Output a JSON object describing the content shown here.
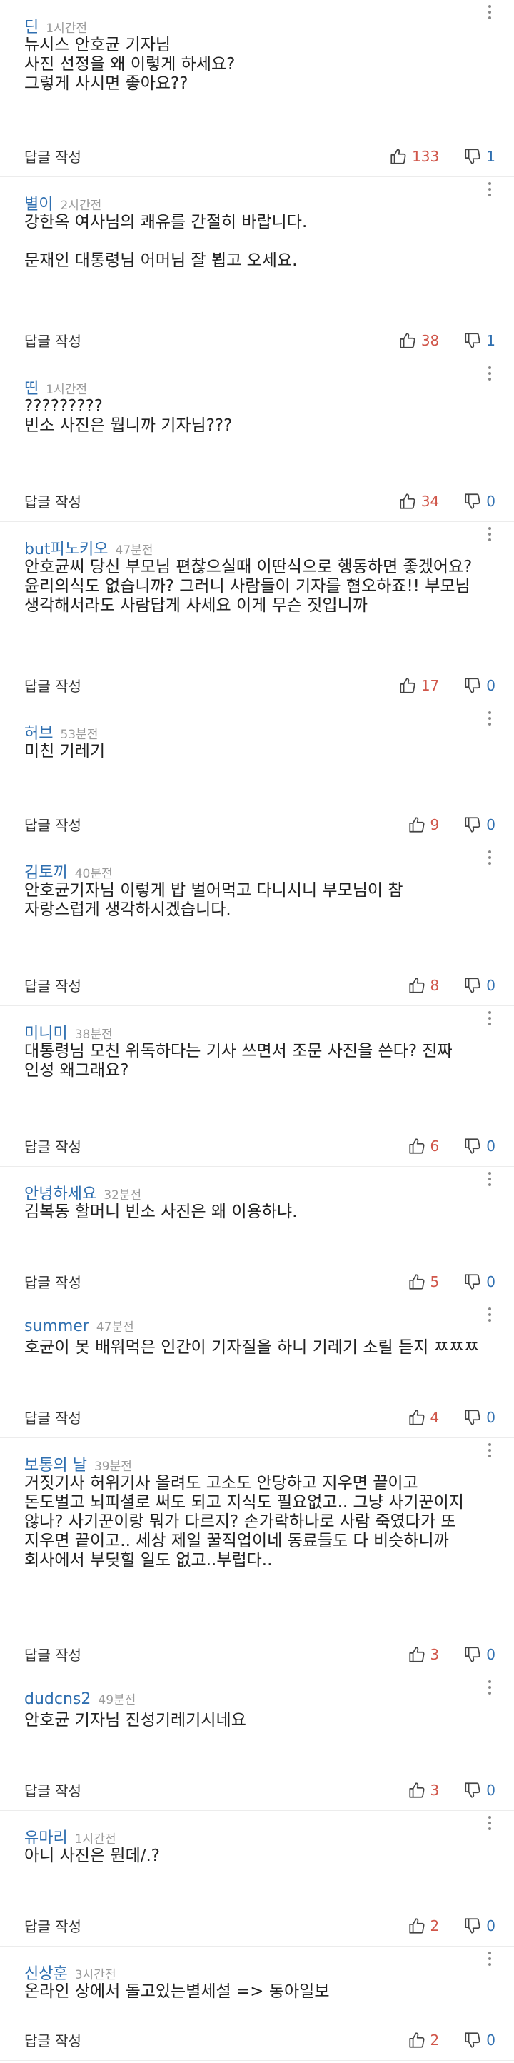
{
  "ui": {
    "reply_label": "답글 작성",
    "icons": {
      "more": "more-vertical-icon",
      "like": "thumbs-up-icon",
      "dislike": "thumbs-down-icon"
    }
  },
  "comments": [
    {
      "nickname": "딘",
      "time": "1시간전",
      "lines": [
        "뉴시스 안호균 기자님",
        "사진 선정을 왜 이렇게 하세요?",
        "그렇게 사시면 좋아요??"
      ],
      "likes": "133",
      "dislikes": "1"
    },
    {
      "nickname": "별이",
      "time": "2시간전",
      "lines": [
        "강한옥 여사님의 쾌유를 간절히 바랍니다.",
        "",
        "문재인 대통령님 어머님 잘 뵙고 오세요."
      ],
      "likes": "38",
      "dislikes": "1"
    },
    {
      "nickname": "띤",
      "time": "1시간전",
      "lines": [
        "?????????",
        "빈소 사진은 뭡니까 기자님???"
      ],
      "likes": "34",
      "dislikes": "0"
    },
    {
      "nickname": "but피노키오",
      "time": "47분전",
      "lines": [
        "안호균씨 당신 부모님 편찮으실때 이딴식으로 행동하면 좋겠어요?",
        "윤리의식도 없습니까? 그러니 사람들이 기자를 혐오하죠!! 부모님",
        "생각해서라도 사람답게 사세요 이게 무슨 짓입니까"
      ],
      "likes": "17",
      "dislikes": "0"
    },
    {
      "nickname": "허브",
      "time": "53분전",
      "lines": [
        "미친 기레기"
      ],
      "likes": "9",
      "dislikes": "0"
    },
    {
      "nickname": "김토끼",
      "time": "40분전",
      "lines": [
        "안호균기자님 이렇게 밥 벌어먹고 다니시니 부모님이 참",
        "자랑스럽게 생각하시겠습니다."
      ],
      "likes": "8",
      "dislikes": "0"
    },
    {
      "nickname": "미니미",
      "time": "38분전",
      "lines": [
        "대통령님 모친 위독하다는 기사 쓰면서 조문 사진을 쓴다? 진짜",
        "인성 왜그래요?"
      ],
      "likes": "6",
      "dislikes": "0"
    },
    {
      "nickname": "안녕하세요",
      "time": "32분전",
      "lines": [
        "김복동 할머니 빈소 사진은 왜 이용하냐."
      ],
      "likes": "5",
      "dislikes": "0"
    },
    {
      "nickname": "summer",
      "time": "47분전",
      "lines": [
        "호균이 못 배워먹은 인간이 기자질을 하니 기레기 소릴 듣지 ㅉㅉㅉ"
      ],
      "likes": "4",
      "dislikes": "0"
    },
    {
      "nickname": "보통의 날",
      "time": "39분전",
      "lines": [
        "거짓기사 허위기사 올려도 고소도 안당하고 지우면 끝이고",
        "돈도벌고 뇌피셜로 써도 되고 지식도 필요없고.. 그냥 사기꾼이지",
        "않나? 사기꾼이랑 뭐가 다르지? 손가락하나로 사람 죽였다가 또",
        "지우면 끝이고.. 세상 제일 꿀직업이네 동료들도 다 비슷하니까",
        "회사에서 부딪힐 일도 없고..부럽다.."
      ],
      "likes": "3",
      "dislikes": "0"
    },
    {
      "nickname": "dudcns2",
      "time": "49분전",
      "lines": [
        "안호균 기자님 진성기레기시네요"
      ],
      "likes": "3",
      "dislikes": "0"
    },
    {
      "nickname": "유마리",
      "time": "1시간전",
      "lines": [
        "아니 사진은 뭔데/.?"
      ],
      "likes": "2",
      "dislikes": "0"
    },
    {
      "nickname": "신상훈",
      "time": "3시간전",
      "lines": [
        "온라인 상에서 돌고있는별세설 => 동아일보"
      ],
      "likes": "2",
      "dislikes": "0"
    }
  ]
}
